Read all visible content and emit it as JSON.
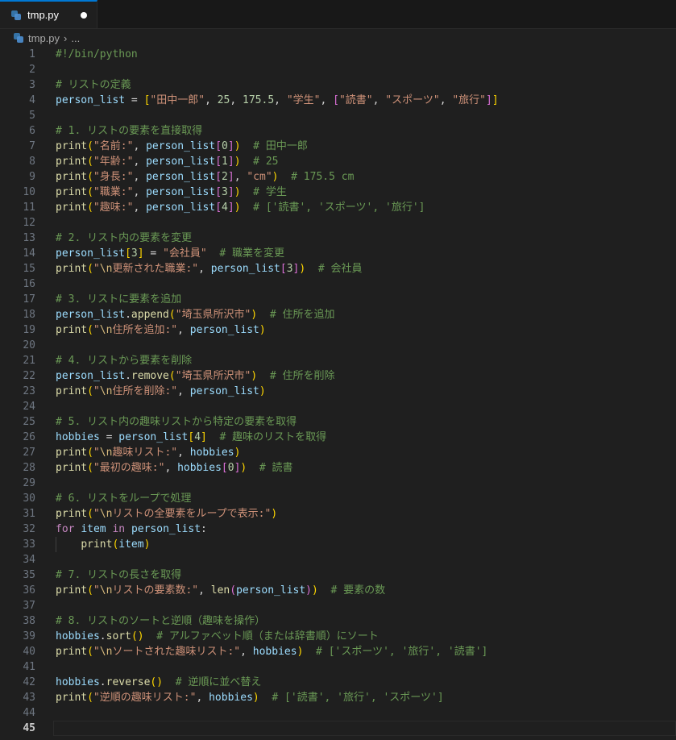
{
  "tab": {
    "filename": "tmp.py",
    "modified": true
  },
  "breadcrumb": {
    "file": "tmp.py",
    "more": "..."
  },
  "editor": {
    "active_line": 45,
    "lines": [
      [
        [
          "com",
          "#!/bin/python"
        ]
      ],
      [],
      [
        [
          "com",
          "# リストの定義"
        ]
      ],
      [
        [
          "var",
          "person_list"
        ],
        [
          "op",
          " = "
        ],
        [
          "bk1",
          "["
        ],
        [
          "str",
          "\"田中一郎\""
        ],
        [
          "op",
          ", "
        ],
        [
          "num",
          "25"
        ],
        [
          "op",
          ", "
        ],
        [
          "num",
          "175.5"
        ],
        [
          "op",
          ", "
        ],
        [
          "str",
          "\"学生\""
        ],
        [
          "op",
          ", "
        ],
        [
          "bk2",
          "["
        ],
        [
          "str",
          "\"読書\""
        ],
        [
          "op",
          ", "
        ],
        [
          "str",
          "\"スポーツ\""
        ],
        [
          "op",
          ", "
        ],
        [
          "str",
          "\"旅行\""
        ],
        [
          "bk2",
          "]"
        ],
        [
          "bk1",
          "]"
        ]
      ],
      [],
      [
        [
          "com",
          "# 1. リストの要素を直接取得"
        ]
      ],
      [
        [
          "fn",
          "print"
        ],
        [
          "bk1",
          "("
        ],
        [
          "str",
          "\"名前:\""
        ],
        [
          "op",
          ", "
        ],
        [
          "var",
          "person_list"
        ],
        [
          "bk2",
          "["
        ],
        [
          "num",
          "0"
        ],
        [
          "bk2",
          "]"
        ],
        [
          "bk1",
          ")"
        ],
        [
          "op",
          "  "
        ],
        [
          "com",
          "# 田中一郎"
        ]
      ],
      [
        [
          "fn",
          "print"
        ],
        [
          "bk1",
          "("
        ],
        [
          "str",
          "\"年齢:\""
        ],
        [
          "op",
          ", "
        ],
        [
          "var",
          "person_list"
        ],
        [
          "bk2",
          "["
        ],
        [
          "num",
          "1"
        ],
        [
          "bk2",
          "]"
        ],
        [
          "bk1",
          ")"
        ],
        [
          "op",
          "  "
        ],
        [
          "com",
          "# 25"
        ]
      ],
      [
        [
          "fn",
          "print"
        ],
        [
          "bk1",
          "("
        ],
        [
          "str",
          "\"身長:\""
        ],
        [
          "op",
          ", "
        ],
        [
          "var",
          "person_list"
        ],
        [
          "bk2",
          "["
        ],
        [
          "num",
          "2"
        ],
        [
          "bk2",
          "]"
        ],
        [
          "op",
          ", "
        ],
        [
          "str",
          "\"cm\""
        ],
        [
          "bk1",
          ")"
        ],
        [
          "op",
          "  "
        ],
        [
          "com",
          "# 175.5 cm"
        ]
      ],
      [
        [
          "fn",
          "print"
        ],
        [
          "bk1",
          "("
        ],
        [
          "str",
          "\"職業:\""
        ],
        [
          "op",
          ", "
        ],
        [
          "var",
          "person_list"
        ],
        [
          "bk2",
          "["
        ],
        [
          "num",
          "3"
        ],
        [
          "bk2",
          "]"
        ],
        [
          "bk1",
          ")"
        ],
        [
          "op",
          "  "
        ],
        [
          "com",
          "# 学生"
        ]
      ],
      [
        [
          "fn",
          "print"
        ],
        [
          "bk1",
          "("
        ],
        [
          "str",
          "\"趣味:\""
        ],
        [
          "op",
          ", "
        ],
        [
          "var",
          "person_list"
        ],
        [
          "bk2",
          "["
        ],
        [
          "num",
          "4"
        ],
        [
          "bk2",
          "]"
        ],
        [
          "bk1",
          ")"
        ],
        [
          "op",
          "  "
        ],
        [
          "com",
          "# ['読書', 'スポーツ', '旅行']"
        ]
      ],
      [],
      [
        [
          "com",
          "# 2. リスト内の要素を変更"
        ]
      ],
      [
        [
          "var",
          "person_list"
        ],
        [
          "bk1",
          "["
        ],
        [
          "num",
          "3"
        ],
        [
          "bk1",
          "]"
        ],
        [
          "op",
          " = "
        ],
        [
          "str",
          "\"会社員\""
        ],
        [
          "op",
          "  "
        ],
        [
          "com",
          "# 職業を変更"
        ]
      ],
      [
        [
          "fn",
          "print"
        ],
        [
          "bk1",
          "("
        ],
        [
          "str",
          "\""
        ],
        [
          "esc",
          "\\n"
        ],
        [
          "str",
          "更新された職業:\""
        ],
        [
          "op",
          ", "
        ],
        [
          "var",
          "person_list"
        ],
        [
          "bk2",
          "["
        ],
        [
          "num",
          "3"
        ],
        [
          "bk2",
          "]"
        ],
        [
          "bk1",
          ")"
        ],
        [
          "op",
          "  "
        ],
        [
          "com",
          "# 会社員"
        ]
      ],
      [],
      [
        [
          "com",
          "# 3. リストに要素を追加"
        ]
      ],
      [
        [
          "var",
          "person_list"
        ],
        [
          "op",
          "."
        ],
        [
          "fn",
          "append"
        ],
        [
          "bk1",
          "("
        ],
        [
          "str",
          "\"埼玉県所沢市\""
        ],
        [
          "bk1",
          ")"
        ],
        [
          "op",
          "  "
        ],
        [
          "com",
          "# 住所を追加"
        ]
      ],
      [
        [
          "fn",
          "print"
        ],
        [
          "bk1",
          "("
        ],
        [
          "str",
          "\""
        ],
        [
          "esc",
          "\\n"
        ],
        [
          "str",
          "住所を追加:\""
        ],
        [
          "op",
          ", "
        ],
        [
          "var",
          "person_list"
        ],
        [
          "bk1",
          ")"
        ]
      ],
      [],
      [
        [
          "com",
          "# 4. リストから要素を削除"
        ]
      ],
      [
        [
          "var",
          "person_list"
        ],
        [
          "op",
          "."
        ],
        [
          "fn",
          "remove"
        ],
        [
          "bk1",
          "("
        ],
        [
          "str",
          "\"埼玉県所沢市\""
        ],
        [
          "bk1",
          ")"
        ],
        [
          "op",
          "  "
        ],
        [
          "com",
          "# 住所を削除"
        ]
      ],
      [
        [
          "fn",
          "print"
        ],
        [
          "bk1",
          "("
        ],
        [
          "str",
          "\""
        ],
        [
          "esc",
          "\\n"
        ],
        [
          "str",
          "住所を削除:\""
        ],
        [
          "op",
          ", "
        ],
        [
          "var",
          "person_list"
        ],
        [
          "bk1",
          ")"
        ]
      ],
      [],
      [
        [
          "com",
          "# 5. リスト内の趣味リストから特定の要素を取得"
        ]
      ],
      [
        [
          "var",
          "hobbies"
        ],
        [
          "op",
          " = "
        ],
        [
          "var",
          "person_list"
        ],
        [
          "bk1",
          "["
        ],
        [
          "num",
          "4"
        ],
        [
          "bk1",
          "]"
        ],
        [
          "op",
          "  "
        ],
        [
          "com",
          "# 趣味のリストを取得"
        ]
      ],
      [
        [
          "fn",
          "print"
        ],
        [
          "bk1",
          "("
        ],
        [
          "str",
          "\""
        ],
        [
          "esc",
          "\\n"
        ],
        [
          "str",
          "趣味リスト:\""
        ],
        [
          "op",
          ", "
        ],
        [
          "var",
          "hobbies"
        ],
        [
          "bk1",
          ")"
        ]
      ],
      [
        [
          "fn",
          "print"
        ],
        [
          "bk1",
          "("
        ],
        [
          "str",
          "\"最初の趣味:\""
        ],
        [
          "op",
          ", "
        ],
        [
          "var",
          "hobbies"
        ],
        [
          "bk2",
          "["
        ],
        [
          "num",
          "0"
        ],
        [
          "bk2",
          "]"
        ],
        [
          "bk1",
          ")"
        ],
        [
          "op",
          "  "
        ],
        [
          "com",
          "# 読書"
        ]
      ],
      [],
      [
        [
          "com",
          "# 6. リストをループで処理"
        ]
      ],
      [
        [
          "fn",
          "print"
        ],
        [
          "bk1",
          "("
        ],
        [
          "str",
          "\""
        ],
        [
          "esc",
          "\\n"
        ],
        [
          "str",
          "リストの全要素をループで表示:\""
        ],
        [
          "bk1",
          ")"
        ]
      ],
      [
        [
          "kw",
          "for"
        ],
        [
          "op",
          " "
        ],
        [
          "var",
          "item"
        ],
        [
          "op",
          " "
        ],
        [
          "kw",
          "in"
        ],
        [
          "op",
          " "
        ],
        [
          "var",
          "person_list"
        ],
        [
          "op",
          ":"
        ]
      ],
      [
        [
          "op",
          "    "
        ],
        [
          "fn",
          "print"
        ],
        [
          "bk1",
          "("
        ],
        [
          "var",
          "item"
        ],
        [
          "bk1",
          ")"
        ]
      ],
      [],
      [
        [
          "com",
          "# 7. リストの長さを取得"
        ]
      ],
      [
        [
          "fn",
          "print"
        ],
        [
          "bk1",
          "("
        ],
        [
          "str",
          "\""
        ],
        [
          "esc",
          "\\n"
        ],
        [
          "str",
          "リストの要素数:\""
        ],
        [
          "op",
          ", "
        ],
        [
          "fn",
          "len"
        ],
        [
          "bk2",
          "("
        ],
        [
          "var",
          "person_list"
        ],
        [
          "bk2",
          ")"
        ],
        [
          "bk1",
          ")"
        ],
        [
          "op",
          "  "
        ],
        [
          "com",
          "# 要素の数"
        ]
      ],
      [],
      [
        [
          "com",
          "# 8. リストのソートと逆順（趣味を操作）"
        ]
      ],
      [
        [
          "var",
          "hobbies"
        ],
        [
          "op",
          "."
        ],
        [
          "fn",
          "sort"
        ],
        [
          "bk1",
          "()"
        ],
        [
          "op",
          "  "
        ],
        [
          "com",
          "# アルファベット順（または辞書順）にソート"
        ]
      ],
      [
        [
          "fn",
          "print"
        ],
        [
          "bk1",
          "("
        ],
        [
          "str",
          "\""
        ],
        [
          "esc",
          "\\n"
        ],
        [
          "str",
          "ソートされた趣味リスト:\""
        ],
        [
          "op",
          ", "
        ],
        [
          "var",
          "hobbies"
        ],
        [
          "bk1",
          ")"
        ],
        [
          "op",
          "  "
        ],
        [
          "com",
          "# ['スポーツ', '旅行', '読書']"
        ]
      ],
      [],
      [
        [
          "var",
          "hobbies"
        ],
        [
          "op",
          "."
        ],
        [
          "fn",
          "reverse"
        ],
        [
          "bk1",
          "()"
        ],
        [
          "op",
          "  "
        ],
        [
          "com",
          "# 逆順に並べ替え"
        ]
      ],
      [
        [
          "fn",
          "print"
        ],
        [
          "bk1",
          "("
        ],
        [
          "str",
          "\"逆順の趣味リスト:\""
        ],
        [
          "op",
          ", "
        ],
        [
          "var",
          "hobbies"
        ],
        [
          "bk1",
          ")"
        ],
        [
          "op",
          "  "
        ],
        [
          "com",
          "# ['読書', '旅行', 'スポーツ']"
        ]
      ],
      [],
      []
    ]
  }
}
